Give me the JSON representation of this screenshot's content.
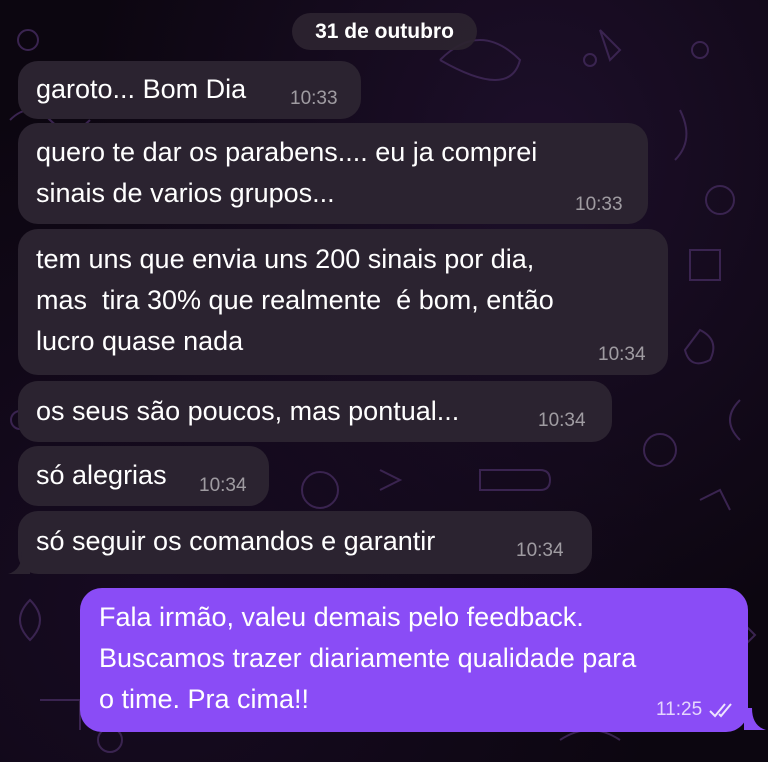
{
  "chat": {
    "date_label": "31 de outubro",
    "messages": [
      {
        "direction": "in",
        "text": "garoto... Bom Dia",
        "time": "10:33"
      },
      {
        "direction": "in",
        "text": "quero te dar os parabens.... eu ja comprei\nsinais de varios grupos...",
        "time": "10:33"
      },
      {
        "direction": "in",
        "text": "tem uns que envia uns 200 sinais por dia,\nmas  tira 30% que realmente  é bom, então\nlucro quase nada",
        "time": "10:34"
      },
      {
        "direction": "in",
        "text": "os seus são poucos, mas pontual...",
        "time": "10:34"
      },
      {
        "direction": "in",
        "text": "só alegrias",
        "time": "10:34"
      },
      {
        "direction": "in",
        "text": "só seguir os comandos e garantir",
        "time": "10:34"
      },
      {
        "direction": "out",
        "text": "Fala irmão, valeu demais pelo feedback.\nBuscamos trazer diariamente qualidade para\no time. Pra cima!!",
        "time": "11:25",
        "status": "read-double-check"
      }
    ]
  },
  "colors": {
    "incoming_bubble": "#2b2330",
    "outgoing_bubble": "#8a4cf6",
    "background": "#0c0610",
    "doodle": "#3a2450"
  },
  "icons": {
    "read_receipt": "double-check-icon"
  }
}
